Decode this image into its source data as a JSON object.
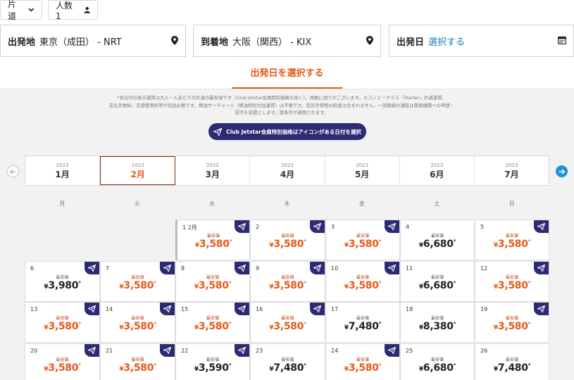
{
  "header": {
    "trip_type": "片道",
    "passengers": "人数 1"
  },
  "search": {
    "origin_label": "出発地",
    "origin_value": "東京（成田） - NRT",
    "dest_label": "到着地",
    "dest_value": "大阪（関西） - KIX",
    "date_label": "出発日",
    "date_value": "選択する"
  },
  "tab": {
    "title": "出発日を選択する"
  },
  "notice": {
    "lines": [
      "*各日付の表示運賃は大人一人あたりの片道の最安値です（Club Jetstar会員特別価格を除く）。席数に限りがございます。エコノミークラス「Starter」片道運賃、",
      "支払手数料、空港使用料等が別途必要です。燃油サーチャージ（燃油特別付加運賃）は不要です。受託手荷物の料金は含まれません。一部路線の運航は関係機関への申請・",
      "認可を前提とします。諸条件が適用されます。"
    ]
  },
  "club_button": "Club Jetstar会員特別価格はアイコンがある日付を選択",
  "months": [
    {
      "year": "2023",
      "month": "1月"
    },
    {
      "year": "2023",
      "month": "2月"
    },
    {
      "year": "2023",
      "month": "3月"
    },
    {
      "year": "2023",
      "month": "4月"
    },
    {
      "year": "2023",
      "month": "5月"
    },
    {
      "year": "2023",
      "month": "6月"
    },
    {
      "year": "2023",
      "month": "7月"
    }
  ],
  "selected_month_index": 1,
  "weekdays": [
    "月",
    "火",
    "水",
    "木",
    "金",
    "土",
    "日"
  ],
  "min_label": "最安値",
  "days": [
    {
      "day": "1 2月",
      "price": "3,580",
      "club": true,
      "orange": true
    },
    {
      "day": "2",
      "price": "3,580",
      "club": true,
      "orange": true
    },
    {
      "day": "3",
      "price": "3,580",
      "club": true,
      "orange": true
    },
    {
      "day": "4",
      "price": "6,680",
      "club": false,
      "orange": false
    },
    {
      "day": "5",
      "price": "3,580",
      "club": true,
      "orange": true
    },
    {
      "day": "6",
      "price": "3,980",
      "club": true,
      "orange": false
    },
    {
      "day": "7",
      "price": "3,580",
      "club": true,
      "orange": true
    },
    {
      "day": "8",
      "price": "3,580",
      "club": true,
      "orange": true
    },
    {
      "day": "9",
      "price": "3,580",
      "club": true,
      "orange": true
    },
    {
      "day": "10",
      "price": "3,580",
      "club": true,
      "orange": true
    },
    {
      "day": "11",
      "price": "6,680",
      "club": false,
      "orange": false
    },
    {
      "day": "12",
      "price": "3,580",
      "club": true,
      "orange": true
    },
    {
      "day": "13",
      "price": "3,580",
      "club": true,
      "orange": true
    },
    {
      "day": "14",
      "price": "3,580",
      "club": true,
      "orange": true
    },
    {
      "day": "15",
      "price": "3,580",
      "club": true,
      "orange": true
    },
    {
      "day": "16",
      "price": "3,580",
      "club": true,
      "orange": true
    },
    {
      "day": "17",
      "price": "7,480",
      "club": false,
      "orange": false
    },
    {
      "day": "18",
      "price": "8,380",
      "club": false,
      "orange": false
    },
    {
      "day": "19",
      "price": "3,580",
      "club": true,
      "orange": true
    },
    {
      "day": "20",
      "price": "3,580",
      "club": true,
      "orange": true
    },
    {
      "day": "21",
      "price": "3,580",
      "club": true,
      "orange": true
    },
    {
      "day": "22",
      "price": "3,590",
      "club": true,
      "orange": false
    },
    {
      "day": "23",
      "price": "7,480",
      "club": false,
      "orange": false
    },
    {
      "day": "24",
      "price": "3,580",
      "club": true,
      "orange": true
    },
    {
      "day": "25",
      "price": "6,680",
      "club": false,
      "orange": false
    },
    {
      "day": "26",
      "price": "7,480",
      "club": false,
      "orange": false
    }
  ]
}
